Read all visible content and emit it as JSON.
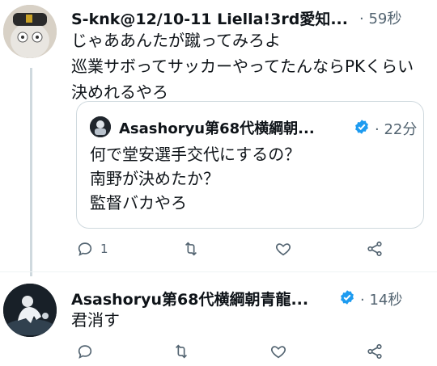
{
  "tweet1": {
    "author": "S-knk@12/10-11 Liella!3rd愛知...",
    "time": "59秒",
    "text": "じゃああんたが蹴ってみろよ\n巡業サボってサッカーやってたんならPKくらい決めれるやろ",
    "reply_count": "1"
  },
  "quote": {
    "author": "Asashoryu第68代横綱朝...",
    "time": "22分",
    "text": "何で堂安選手交代にするの？\n南野が決めたか？\n監督バカやろ"
  },
  "tweet2": {
    "author": "Asashoryu第68代横綱朝青龍...",
    "time": "14秒",
    "text": "君消す"
  },
  "colors": {
    "verified": "#1d9bf0",
    "muted": "#536471"
  },
  "icons": [
    "reply-icon",
    "retweet-icon",
    "like-icon",
    "share-icon",
    "verified-badge-icon"
  ]
}
